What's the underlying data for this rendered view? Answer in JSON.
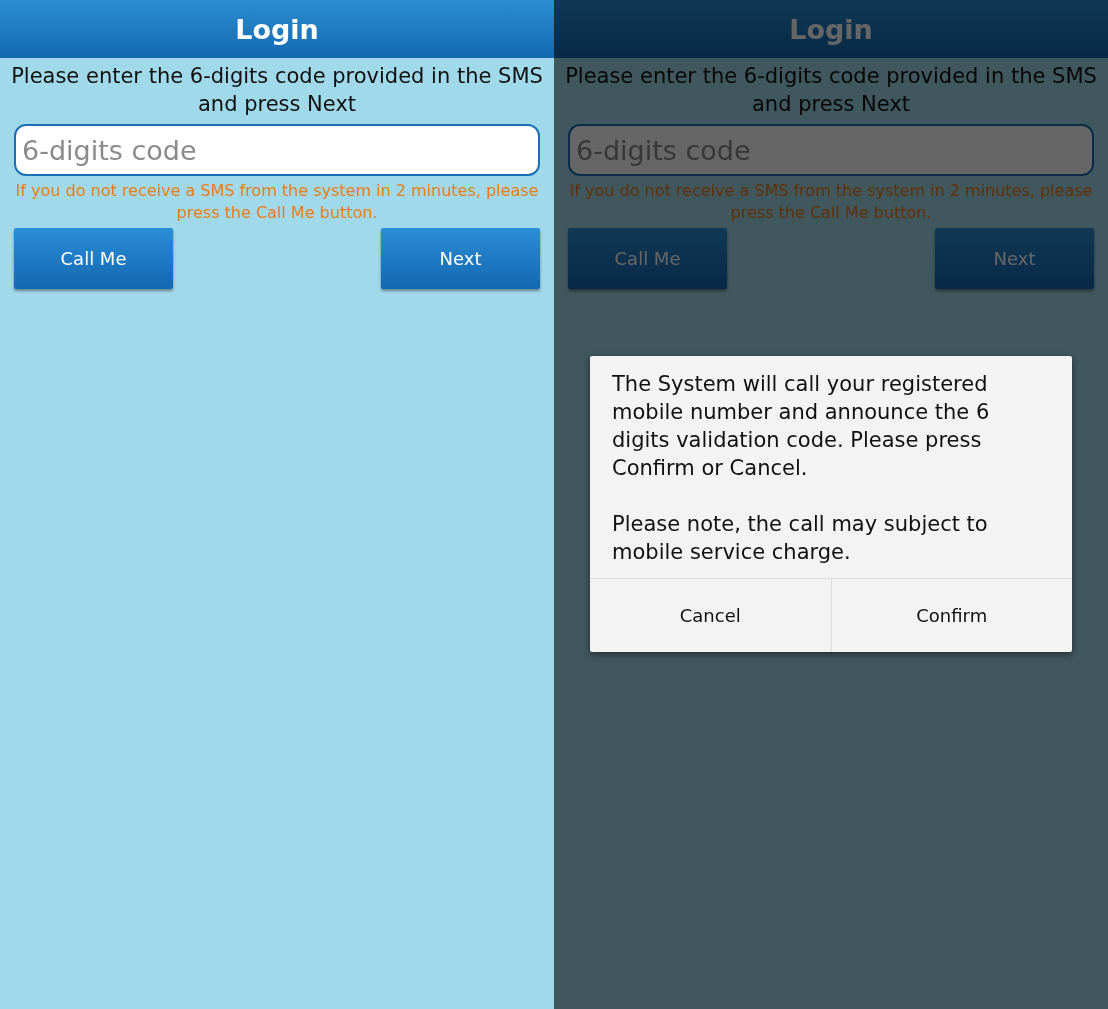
{
  "screens": [
    {
      "title": "Login",
      "instruction": "Please enter the 6-digits code provided in the SMS and press Next",
      "code_field": {
        "placeholder": "6-digits code"
      },
      "hint": "If you do not receive a SMS from the system in 2 minutes, please press the Call Me button.",
      "buttons": [
        "Call Me",
        "Next"
      ],
      "dimmed": false
    },
    {
      "title": "Login",
      "instruction": "Please enter the 6-digits code provided in the SMS and press Next",
      "code_field": {
        "placeholder": "6-digits code"
      },
      "hint": "If you do not receive a SMS from the system in 2 minutes, please press the Call Me button.",
      "buttons": [
        "Call Me",
        "Next"
      ],
      "dimmed": true,
      "dialog": {
        "paragraphs": [
          "The System will call your registered mobile number and announce the 6 digits validation code. Please press Confirm or Cancel.",
          "Please note, the call may subject to mobile service charge."
        ],
        "buttons": [
          "Cancel",
          "Confirm"
        ]
      }
    }
  ]
}
